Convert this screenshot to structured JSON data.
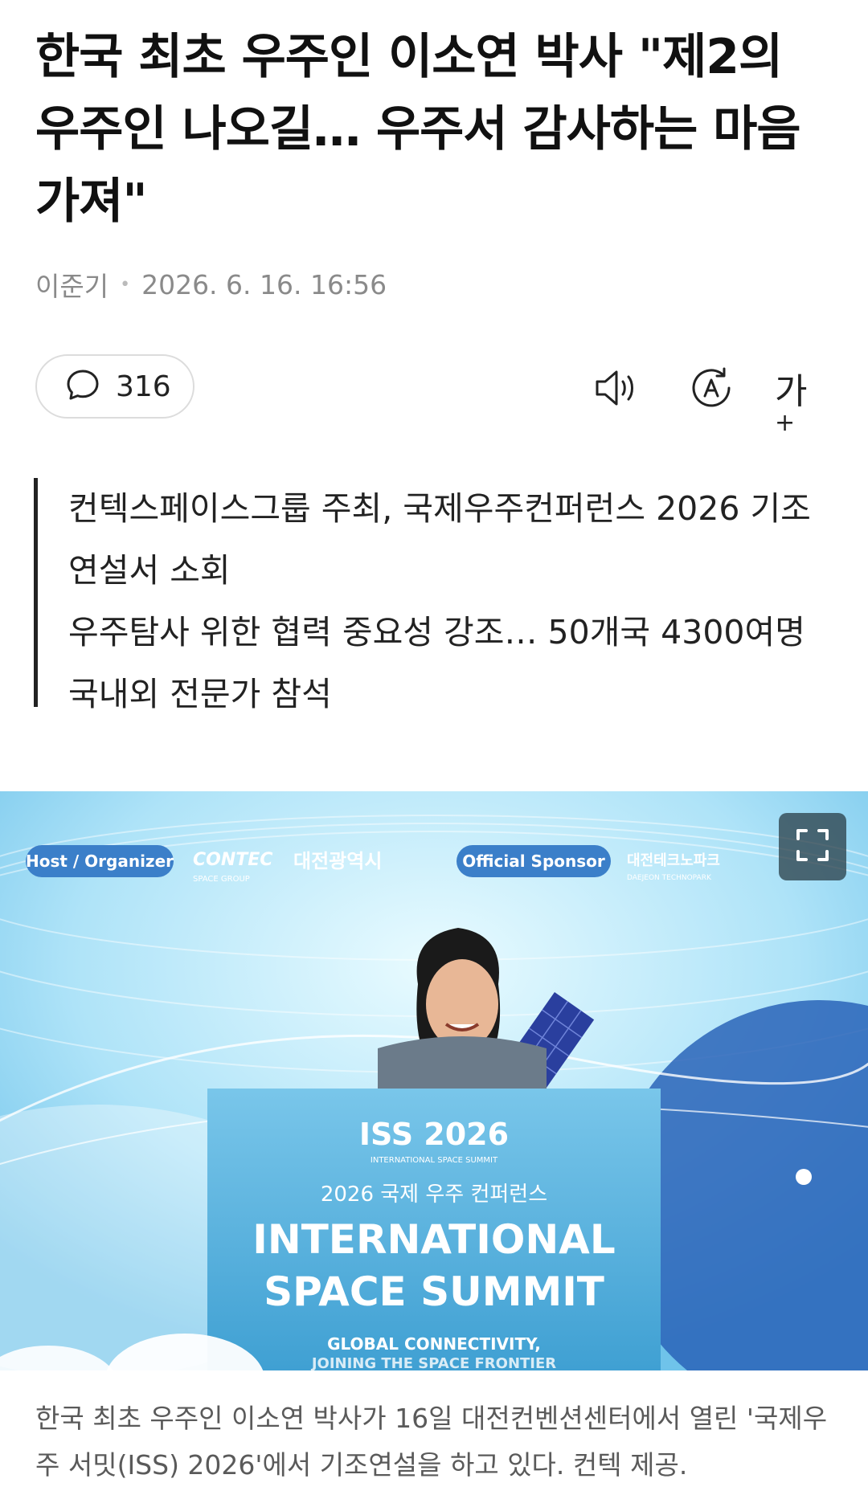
{
  "article": {
    "headline": "한국 최초 우주인 이소연 박사 \"제2의 우주인 나오길… 우주서 감사하는 마음 가져\"",
    "author": "이준기",
    "datetime": "2026. 6. 16. 16:56",
    "summary_line1": "컨텍스페이스그룹 주최, 국제우주컨퍼런스 2026 기조연설서 소회",
    "summary_line2": "우주탐사 위한 협력 중요성 강조… 50개국 4300여명 국내외 전문가 참석",
    "caption": "한국 최초 우주인 이소연 박사가 16일 대전컨벤션센터에서 열린 '국제우주 서밋(ISS) 2026'에서 기조연설을 하고 있다. 컨텍 제공."
  },
  "toolbar": {
    "comment_count": "316",
    "font_size_label": "가",
    "font_size_plus": "+",
    "icons": [
      "comment-icon",
      "speaker-icon",
      "translate-icon",
      "font-size-icon"
    ]
  },
  "photo": {
    "banner_host": "Host / Organizer",
    "banner_sponsor": "Official Sponsor",
    "banner_contec": "CONTEC",
    "banner_contec_sub": "SPACE GROUP",
    "banner_daejeon": "대전광역시",
    "banner_techno": "대전테크노파크",
    "banner_techno_sub": "DAEJEON TECHNOPARK",
    "podium_logo": "ISS 2026",
    "podium_logo_sub": "INTERNATIONAL SPACE SUMMIT",
    "podium_kr": "2026 국제 우주 컨퍼런스",
    "podium_line1": "INTERNATIONAL",
    "podium_line2": "SPACE SUMMIT",
    "podium_tagline1": "GLOBAL CONNECTIVITY,",
    "podium_tagline2": "JOINING THE SPACE FRONTIER"
  },
  "colors": {
    "sky": "#9fdcf6",
    "podium": "#4aa8d6",
    "accent_blue": "#2f80c8"
  }
}
